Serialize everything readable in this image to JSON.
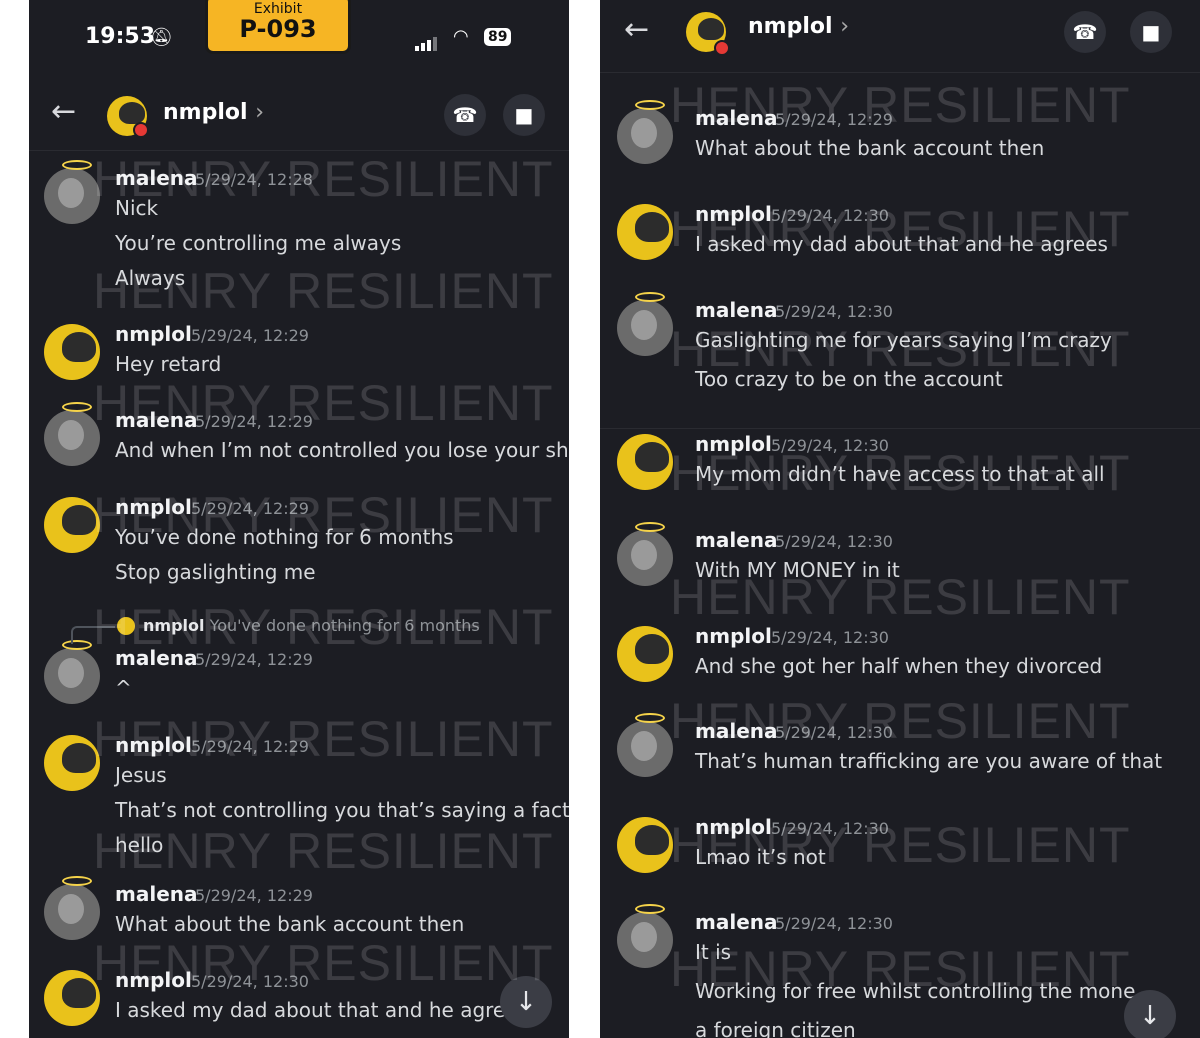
{
  "exhibit": {
    "label": "Exhibit",
    "id": "P-093"
  },
  "statusbar": {
    "time": "19:53",
    "battery": "89"
  },
  "header": {
    "name": "nmplol",
    "chevron": "›"
  },
  "watermark": "HENRY RESILIENT",
  "left": {
    "reply": {
      "user": "nmplol",
      "text": "You've done nothing for 6 months"
    },
    "messages": [
      {
        "user": "malena",
        "time": "5/29/24, 12:28",
        "lines": [
          "Nick",
          "You’re controlling me always",
          "Always"
        ]
      },
      {
        "user": "nmplol",
        "time": "5/29/24, 12:29",
        "lines": [
          "Hey retard"
        ]
      },
      {
        "user": "malena",
        "time": "5/29/24, 12:29",
        "lines": [
          "And when I’m not controlled you lose your shit"
        ]
      },
      {
        "user": "nmplol",
        "time": "5/29/24, 12:29",
        "lines": [
          "You’ve done nothing for 6 months",
          "Stop gaslighting me"
        ]
      },
      {
        "user": "malena",
        "time": "5/29/24, 12:29",
        "lines": [
          "^"
        ]
      },
      {
        "user": "nmplol",
        "time": "5/29/24, 12:29",
        "lines": [
          "Jesus",
          "That’s not controlling you that’s saying a fact",
          "hello"
        ]
      },
      {
        "user": "malena",
        "time": "5/29/24, 12:29",
        "lines": [
          "What about the bank account then"
        ]
      },
      {
        "user": "nmplol",
        "time": "5/29/24, 12:30",
        "lines": [
          "I asked my dad about that and he agrees"
        ]
      }
    ]
  },
  "right": {
    "messages": [
      {
        "user": "malena",
        "time": "5/29/24, 12:29",
        "lines": [
          "What about the bank account then"
        ]
      },
      {
        "user": "nmplol",
        "time": "5/29/24, 12:30",
        "lines": [
          "I asked my dad about that and he agrees"
        ]
      },
      {
        "user": "malena",
        "time": "5/29/24, 12:30",
        "lines": [
          "Gaslighting me for years saying I’m crazy",
          "Too crazy to be on the account"
        ]
      },
      {
        "user": "nmplol",
        "time": "5/29/24, 12:30",
        "lines": [
          "My mom didn’t have access to that at all"
        ]
      },
      {
        "user": "malena",
        "time": "5/29/24, 12:30",
        "lines": [
          "With MY MONEY in it"
        ]
      },
      {
        "user": "nmplol",
        "time": "5/29/24, 12:30",
        "lines": [
          "And she got her half when they divorced"
        ]
      },
      {
        "user": "malena",
        "time": "5/29/24, 12:30",
        "lines": [
          "That’s human trafficking are you aware of that"
        ]
      },
      {
        "user": "nmplol",
        "time": "5/29/24, 12:30",
        "lines": [
          "Lmao it’s not"
        ]
      },
      {
        "user": "malena",
        "time": "5/29/24, 12:30",
        "lines": [
          "It is",
          "Working for free whilst controlling the mone",
          "a foreign citizen"
        ]
      }
    ]
  },
  "icons": {
    "back": "arrow-left-icon",
    "call": "phone-icon",
    "video": "video-camera-icon",
    "scroll": "arrow-down-icon"
  }
}
